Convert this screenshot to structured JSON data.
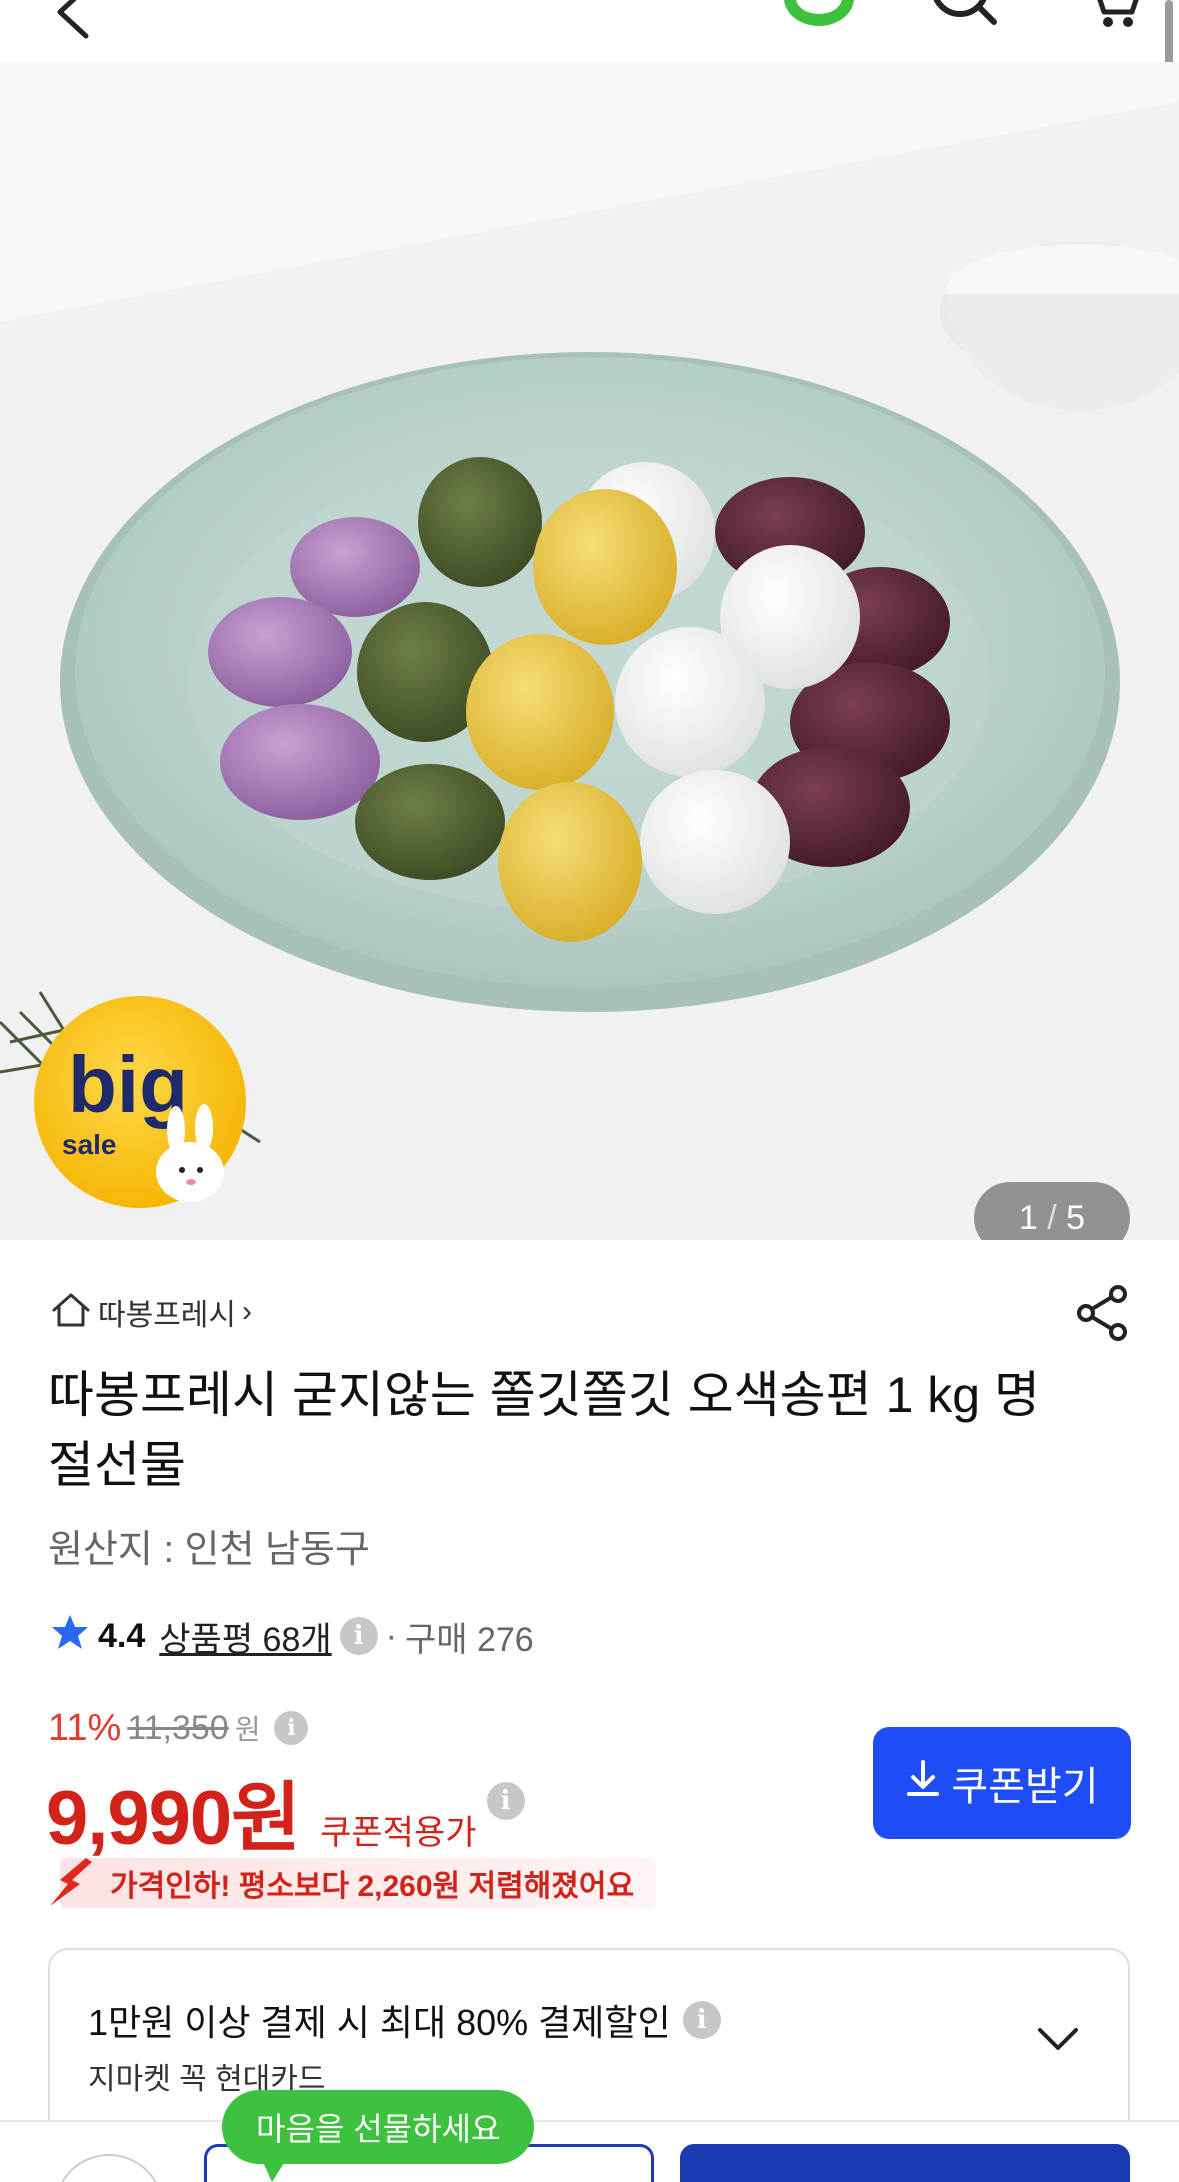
{
  "header": {
    "back_icon": "chevron-left-icon",
    "status_icon": "green-ring-icon",
    "search_icon": "search-icon",
    "cart_icon": "cart-icon"
  },
  "gallery": {
    "current": "1",
    "separator": "/",
    "total": "5",
    "badge_text": "big",
    "badge_sub": "sale"
  },
  "seller": {
    "name": "따봉프레시",
    "chevron": "›"
  },
  "product": {
    "title": "따봉프레시 굳지않는 쫄깃쫄깃 오색송편 1 kg 명절선물",
    "origin": "원산지 : 인천 남동구"
  },
  "rating": {
    "score": "4.4",
    "reviews": "상품평 68개",
    "dot": "·",
    "purchases": "구매 276"
  },
  "pricing": {
    "discount": "11%",
    "original_price": "11,350",
    "original_won": "원",
    "price": "9,990원",
    "coupon_applied": "쿠폰적용가",
    "coupon_button": "쿠폰받기",
    "price_drop": "가격인하! 평소보다 2,260원 저렴해졌어요"
  },
  "card_offer": {
    "headline": "1만원 이상 결제 시 최대 80% 결제할인",
    "sub": "지마켓 꼭 현대카드"
  },
  "bottom": {
    "tooltip": "마음을 선물하세요"
  },
  "colors": {
    "accent_blue": "#1e4cf5",
    "price_red": "#d1231a",
    "green": "#3ec13e"
  }
}
